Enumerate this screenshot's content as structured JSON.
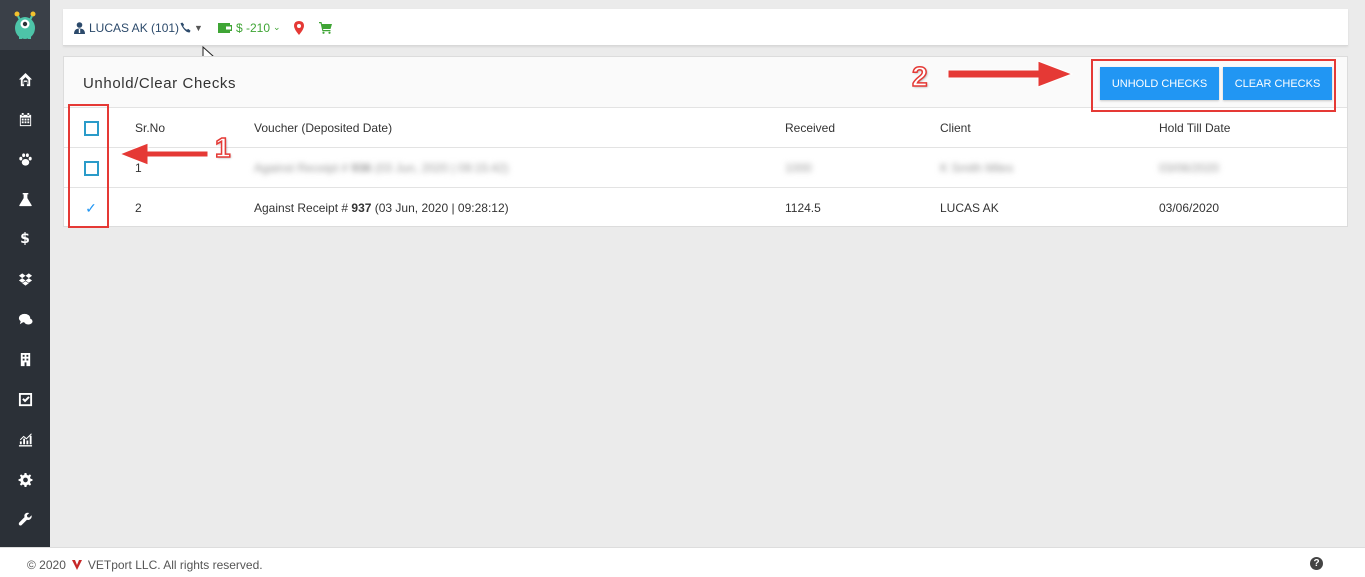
{
  "sidebar": {
    "items": [
      {
        "icon": "home-icon"
      },
      {
        "icon": "calendar-icon"
      },
      {
        "icon": "paw-icon"
      },
      {
        "icon": "flask-icon"
      },
      {
        "icon": "dollar-icon",
        "glyph": "$"
      },
      {
        "icon": "dropbox-icon"
      },
      {
        "icon": "chat-icon"
      },
      {
        "icon": "building-icon"
      },
      {
        "icon": "checkbox-icon"
      },
      {
        "icon": "chart-icon"
      },
      {
        "icon": "gear-icon"
      },
      {
        "icon": "wrench-icon"
      }
    ]
  },
  "topbar": {
    "user_label": "LUCAS AK (101)",
    "wallet_label": "$ -210",
    "colors": {
      "user": "#2c4a6b",
      "wallet": "#3fa535",
      "pin": "#e53935"
    }
  },
  "panel": {
    "title": "Unhold/Clear Checks",
    "unhold_label": "UNHOLD CHECKS",
    "clear_label": "CLEAR CHECKS",
    "accent": "#2196f3"
  },
  "table": {
    "headers": {
      "sr": "Sr.No",
      "voucher": "Voucher (Deposited Date)",
      "received": "Received",
      "client": "Client",
      "hold": "Hold Till Date"
    },
    "rows": [
      {
        "checked": false,
        "sr": "1",
        "voucher_prefix": "Against Receipt # ",
        "voucher_number": "936",
        "voucher_suffix": " (03 Jun, 2020 | 09:15:42)",
        "received": "1000",
        "client": "K Smith Miles",
        "hold": "03/06/2020",
        "blurred": true
      },
      {
        "checked": true,
        "sr": "2",
        "voucher_prefix": "Against Receipt # ",
        "voucher_number": "937",
        "voucher_suffix": " (03 Jun, 2020 | 09:28:12)",
        "received": "1124.5",
        "client": "LUCAS AK",
        "hold": "03/06/2020",
        "blurred": false
      }
    ]
  },
  "annotations": {
    "step1": "1",
    "step2": "2",
    "color": "#e53935"
  },
  "footer": {
    "copyright_prefix": "© 2020",
    "copyright_suffix": "VETport LLC. All rights reserved.",
    "help_glyph": "?"
  }
}
